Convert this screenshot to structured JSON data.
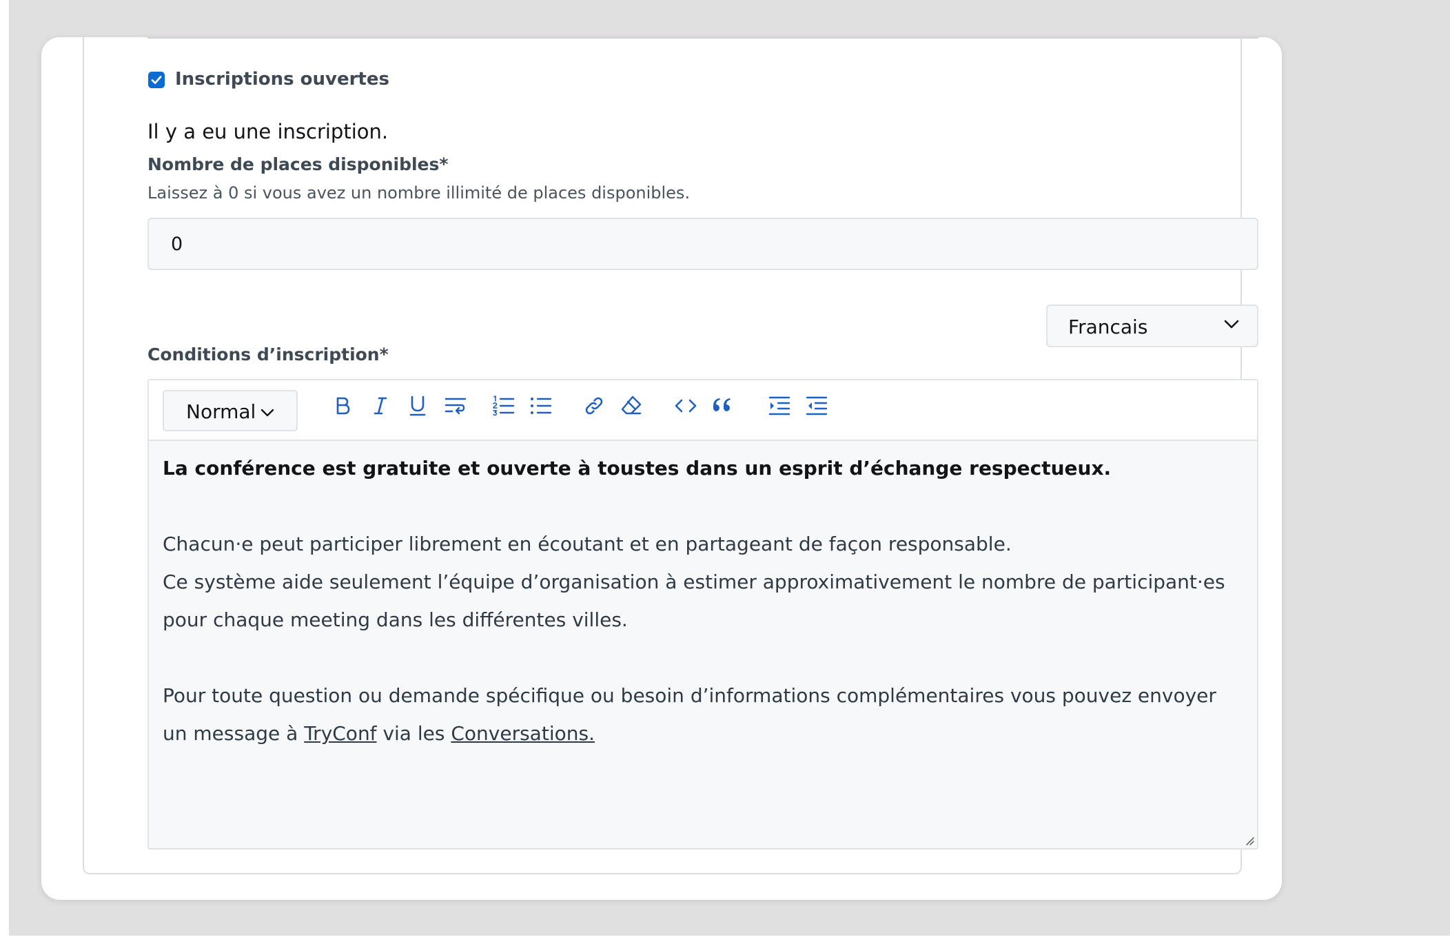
{
  "registration": {
    "checkbox_label": "Inscriptions ouvertes",
    "checked": true,
    "count_text": "Il y a eu une inscription."
  },
  "places": {
    "label": "Nombre de places disponibles*",
    "help": "Laissez à 0 si vous avez un nombre illimité de places disponibles.",
    "value": "0"
  },
  "language_select": {
    "value": "Francais"
  },
  "conditions": {
    "label": "Conditions d’inscription*",
    "format_select": "Normal",
    "toolbar_icons": [
      "bold-icon",
      "italic-icon",
      "underline-icon",
      "text-wrap-icon",
      "ordered-list-icon",
      "bullet-list-icon",
      "link-icon",
      "eraser-icon",
      "code-icon",
      "quote-icon",
      "indent-icon",
      "outdent-icon"
    ],
    "body": {
      "bold_line": "La conférence est gratuite et ouverte à toustes dans un esprit d’échange respectueux.",
      "line1": "Chacun·e peut participer librement en écoutant et en partageant de façon responsable.",
      "line2": "Ce système aide seulement l’équipe d’organisation à estimer approximativement le nombre de participant·es pour chaque meeting dans les différentes villes.",
      "line3_pre": "Pour toute question ou demande spécifique ou besoin d’informations complémentaires vous pouvez envoyer un message à ",
      "link1": "TryConf",
      "line3_mid": " via les ",
      "link2": "Conversations."
    }
  },
  "colors": {
    "accent": "#0b6bd3",
    "icon": "#1f5fbf"
  }
}
